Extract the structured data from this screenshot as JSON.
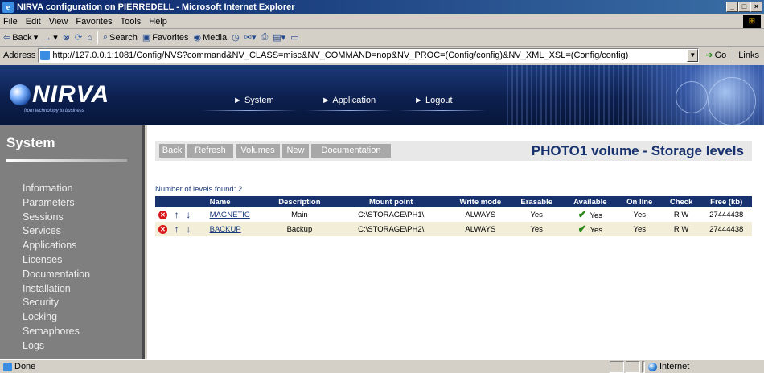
{
  "window": {
    "title": "NIRVA configuration on PIERREDELL - Microsoft Internet Explorer"
  },
  "menu": [
    "File",
    "Edit",
    "View",
    "Favorites",
    "Tools",
    "Help"
  ],
  "toolbar": {
    "back": "Back",
    "search": "Search",
    "favorites": "Favorites",
    "media": "Media"
  },
  "address": {
    "label": "Address",
    "url": "http://127.0.0.1:1081/Config/NVS?command&NV_CLASS=misc&NV_COMMAND=nop&NV_PROC=(Config/config)&NV_XML_XSL=(Config/config)",
    "go": "Go",
    "links": "Links"
  },
  "banner": {
    "logo": "NIRVA",
    "tagline": "from technology to business",
    "nav": [
      "System",
      "Application",
      "Logout"
    ]
  },
  "sidebar": {
    "title": "System",
    "items": [
      "Information",
      "Parameters",
      "Sessions",
      "Services",
      "Applications",
      "Licenses",
      "Documentation",
      "Installation",
      "Security",
      "Locking",
      "Semaphores",
      "Logs"
    ]
  },
  "actions": [
    "Back",
    "Refresh",
    "Volumes",
    "New",
    "Documentation"
  ],
  "page_title": "PHOTO1 volume - Storage levels",
  "count_text": "Number of levels found: 2",
  "table": {
    "columns": [
      "Name",
      "Description",
      "Mount point",
      "Write mode",
      "Erasable",
      "Available",
      "On line",
      "Check",
      "Free (kb)"
    ],
    "rows": [
      {
        "name": "MAGNETIC",
        "description": "Main",
        "mount_point": "C:\\STORAGE\\PH1\\",
        "write_mode": "ALWAYS",
        "erasable": "Yes",
        "available": "Yes",
        "online": "Yes",
        "check": "R W",
        "free": "27444438"
      },
      {
        "name": "BACKUP",
        "description": "Backup",
        "mount_point": "C:\\STORAGE\\PH2\\",
        "write_mode": "ALWAYS",
        "erasable": "Yes",
        "available": "Yes",
        "online": "Yes",
        "check": "R W",
        "free": "27444438"
      }
    ]
  },
  "status": {
    "text": "Done",
    "zone": "Internet"
  }
}
